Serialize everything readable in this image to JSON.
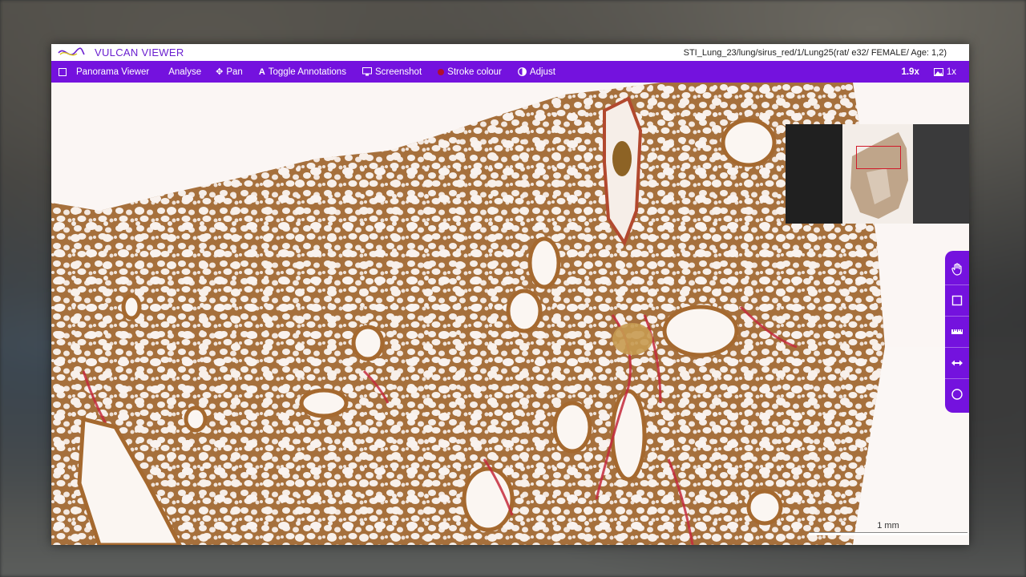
{
  "app": {
    "title": "VULCAN VIEWER",
    "file_path": "STI_Lung_23/lung/sirus_red/1/Lung25(rat/ e32/ FEMALE/ Age: 1,2)"
  },
  "toolbar": {
    "panorama_label": "Panorama Viewer",
    "analyse_label": "Analyse",
    "pan_label": "Pan",
    "toggle_annotations_label": "Toggle Annotations",
    "screenshot_label": "Screenshot",
    "stroke_colour_label": "Stroke colour",
    "adjust_label": "Adjust",
    "zoom_level": "1.9x",
    "resolution_label": "1x"
  },
  "tools": [
    {
      "name": "hand-tool",
      "icon": "hand-icon"
    },
    {
      "name": "rectangle-tool",
      "icon": "square-icon"
    },
    {
      "name": "ruler-tool",
      "icon": "ruler-icon"
    },
    {
      "name": "measure-tool",
      "icon": "double-arrow-icon"
    },
    {
      "name": "circle-tool",
      "icon": "circle-icon"
    }
  ],
  "scalebar": {
    "label": "1 mm"
  },
  "colors": {
    "accent": "#7412de",
    "stroke": "#b0102c",
    "tissue": "#a8733e",
    "collagen": "#c0203a"
  }
}
